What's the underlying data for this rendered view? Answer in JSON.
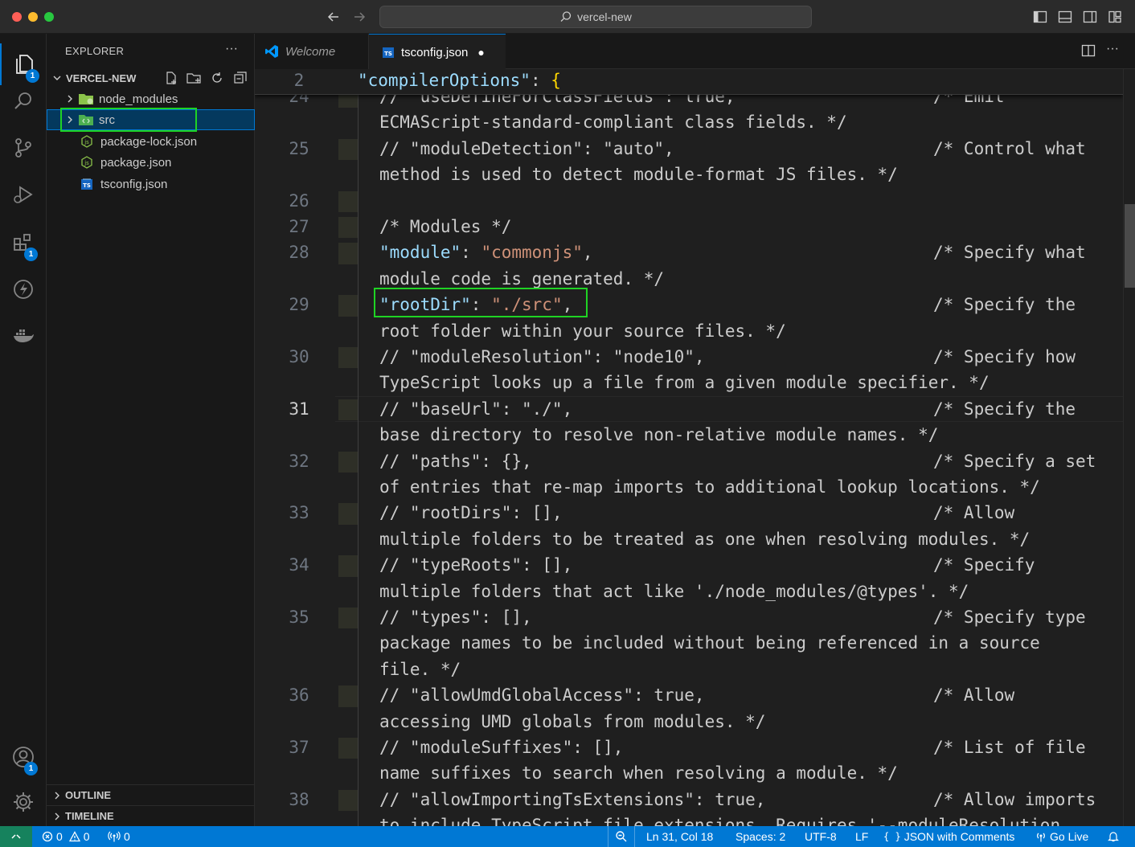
{
  "window": {
    "title": "vercel-new"
  },
  "activity_bar": {
    "explorer_badge": "1",
    "extensions_badge": "1",
    "accounts_badge": "1"
  },
  "sidebar": {
    "title": "EXPLORER",
    "more": "···",
    "root_label": "VERCEL-NEW",
    "items": [
      {
        "label": "node_modules",
        "type": "folder",
        "selected": false
      },
      {
        "label": "src",
        "type": "folder",
        "selected": true
      },
      {
        "label": "package-lock.json",
        "type": "json",
        "selected": false
      },
      {
        "label": "package.json",
        "type": "json",
        "selected": false
      },
      {
        "label": "tsconfig.json",
        "type": "tsconfig",
        "selected": false
      }
    ],
    "outline_label": "OUTLINE",
    "timeline_label": "TIMELINE"
  },
  "tabs": [
    {
      "label": "Welcome",
      "active": false
    },
    {
      "label": "tsconfig.json",
      "active": true,
      "modified_dot": "●"
    }
  ],
  "editor": {
    "sticky": {
      "line": "2",
      "key": "\"compilerOptions\"",
      "punct": ": ",
      "brace": "{"
    },
    "lines": [
      {
        "n": "24",
        "text": "// \"useDefineForClassFields\": true,",
        "cm": "/* Emit",
        "cont": "ECMAScript-standard-compliant class fields. */"
      },
      {
        "n": "25",
        "text": "// \"moduleDetection\": \"auto\",",
        "cm": "/* Control what",
        "cont": "method is used to detect module-format JS files. */"
      },
      {
        "n": "26",
        "text": "",
        "cm": "",
        "cont": ""
      },
      {
        "n": "27",
        "text": "/* Modules */",
        "cm": "",
        "cont": ""
      },
      {
        "n": "28",
        "key": "\"module\"",
        "val": "\"commonjs\"",
        "cm": "/* Specify what",
        "cont": "module code is generated. */"
      },
      {
        "n": "29",
        "key": "\"rootDir\"",
        "val": "\"./src\"",
        "cm": "/* Specify the",
        "cont": "root folder within your source files. */"
      },
      {
        "n": "30",
        "text": "// \"moduleResolution\": \"node10\",",
        "cm": "/* Specify how",
        "cont": "TypeScript looks up a file from a given module specifier. */"
      },
      {
        "n": "31",
        "text": "// \"baseUrl\": \"./\",",
        "cm": "/* Specify the",
        "cont": "base directory to resolve non-relative module names. */"
      },
      {
        "n": "32",
        "text": "// \"paths\": {},",
        "cm": "/* Specify a set",
        "cont": "of entries that re-map imports to additional lookup locations. */"
      },
      {
        "n": "33",
        "text": "// \"rootDirs\": [],",
        "cm": "/* Allow",
        "cont": "multiple folders to be treated as one when resolving modules. */"
      },
      {
        "n": "34",
        "text": "// \"typeRoots\": [],",
        "cm": "/* Specify",
        "cont": "multiple folders that act like './node_modules/@types'. */"
      },
      {
        "n": "35",
        "text": "// \"types\": [],",
        "cm": "/* Specify type",
        "cont": "package names to be included without being referenced in a source",
        "cont2": "file. */"
      },
      {
        "n": "36",
        "text": "// \"allowUmdGlobalAccess\": true,",
        "cm": "/* Allow",
        "cont": "accessing UMD globals from modules. */"
      },
      {
        "n": "37",
        "text": "// \"moduleSuffixes\": [],",
        "cm": "/* List of file",
        "cont": "name suffixes to search when resolving a module. */"
      },
      {
        "n": "38",
        "text": "// \"allowImportingTsExtensions\": true,",
        "cm": "/* Allow imports",
        "cont": "to include TypeScript file extensions. Requires '--moduleResolution"
      }
    ]
  },
  "status_bar": {
    "errors": "0",
    "warnings": "0",
    "ports": "0",
    "cursor": "Ln 31, Col 18",
    "spaces": "Spaces: 2",
    "encoding": "UTF-8",
    "eol": "LF",
    "language": "JSON with Comments",
    "golive": "Go Live"
  },
  "colors": {
    "accent": "#0078d4",
    "highlight_box": "#1fd324",
    "string": "#ce9178",
    "key": "#9cdcfe",
    "brace": "#ffd700"
  }
}
